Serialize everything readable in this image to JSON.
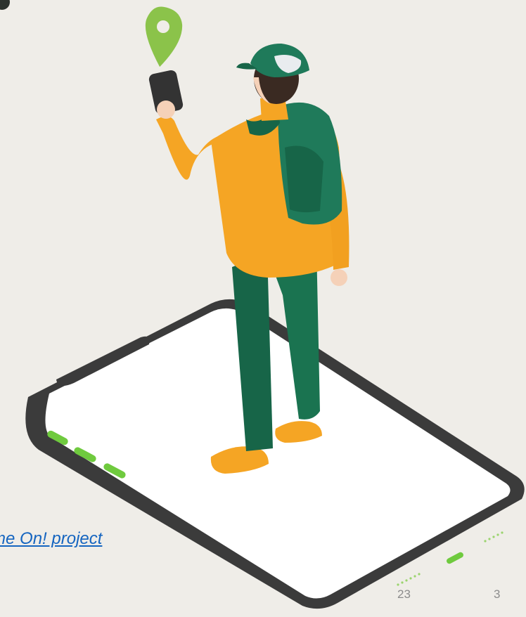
{
  "slide": {
    "link_text": "Game On! project",
    "footer_date": "23",
    "page_number": "3"
  },
  "icons": {
    "location_pin": "location-pin-icon",
    "corner": "corner-icon"
  },
  "colors": {
    "background": "#efede8",
    "link": "#1565c0",
    "footer_text": "#8c8c8c",
    "phone_body": "#3b3b3b",
    "phone_screen": "#ffffff",
    "phone_accent": "#6fca3e",
    "jacket": "#f5a524",
    "pants": "#176548",
    "backpack": "#1f7a5a",
    "pin": "#8bc34a"
  }
}
